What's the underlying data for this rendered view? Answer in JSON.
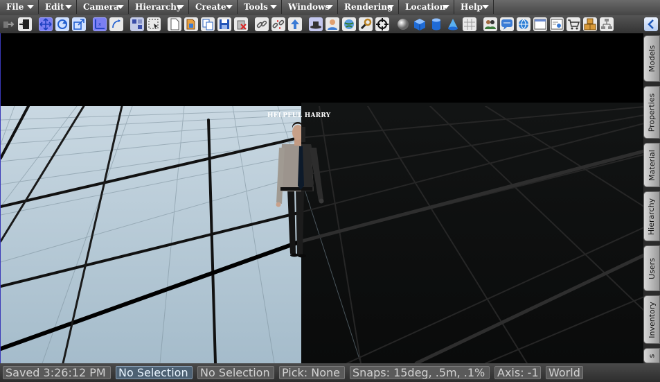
{
  "menu": {
    "file": "File",
    "edit": "Edit",
    "camera": "Camera",
    "hierarchy": "Hierarchy",
    "create": "Create",
    "tools": "Tools",
    "windows": "Windows",
    "rendering": "Rendering",
    "location": "Location",
    "help": "Help"
  },
  "toolbar": {
    "icons": [
      "exit-icon",
      "door-icon",
      "move-icon",
      "rotate-icon",
      "scale-icon",
      "axis-icon",
      "axis-rotate-icon",
      "select-icon",
      "marquee-select-icon",
      "new-file-icon",
      "open-file-icon",
      "copy-icon",
      "save-icon",
      "delete-icon",
      "link-icon",
      "unlink-icon",
      "upload-icon",
      "hat-icon",
      "user-icon",
      "globe-icon",
      "wrench-icon",
      "crosshair-icon",
      "sphere-icon",
      "cube-icon",
      "cylinder-icon",
      "cone-icon",
      "grid-icon",
      "group-icon",
      "chat-icon",
      "world-icon",
      "window-icon",
      "layout-icon",
      "cart-icon",
      "boxes-icon",
      "network-icon"
    ]
  },
  "viewport": {
    "npc_label": "HELPFUL HARRY"
  },
  "side_tabs": {
    "models": "Models",
    "properties": "Properties",
    "material": "Material",
    "hierarchy": "Hierarchy",
    "users": "Users",
    "inventory": "Inventory",
    "last": "s"
  },
  "status": {
    "saved": "Saved 3:26:12 PM",
    "selection_primary": "No Selection",
    "selection_secondary": "No Selection",
    "pick": "Pick: None",
    "snaps": "Snaps: 15deg, .5m, .1%",
    "axis": "Axis: -1",
    "space": "World"
  },
  "colors": {
    "active_tool": "#7b7ff2",
    "floor_lit": "#a9bfcc",
    "floor_dark": "#0c0d0d",
    "sky": "#000000"
  }
}
